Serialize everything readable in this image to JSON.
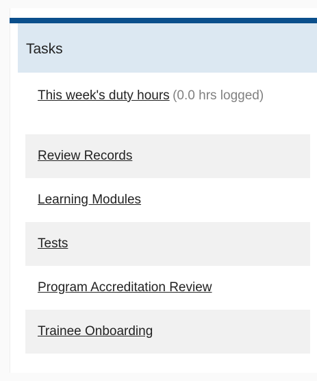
{
  "panel": {
    "title": "Tasks",
    "accent_color": "#0b4f8c",
    "header_bg": "#dce8f2",
    "alt_row_bg": "#f1f1f1"
  },
  "tasks": [
    {
      "label": "This week's duty hours",
      "note": "(0.0 hrs logged)"
    },
    {
      "label": "Review Records"
    },
    {
      "label": "Learning Modules"
    },
    {
      "label": "Tests"
    },
    {
      "label": "Program Accreditation Review"
    },
    {
      "label": "Trainee Onboarding"
    }
  ]
}
